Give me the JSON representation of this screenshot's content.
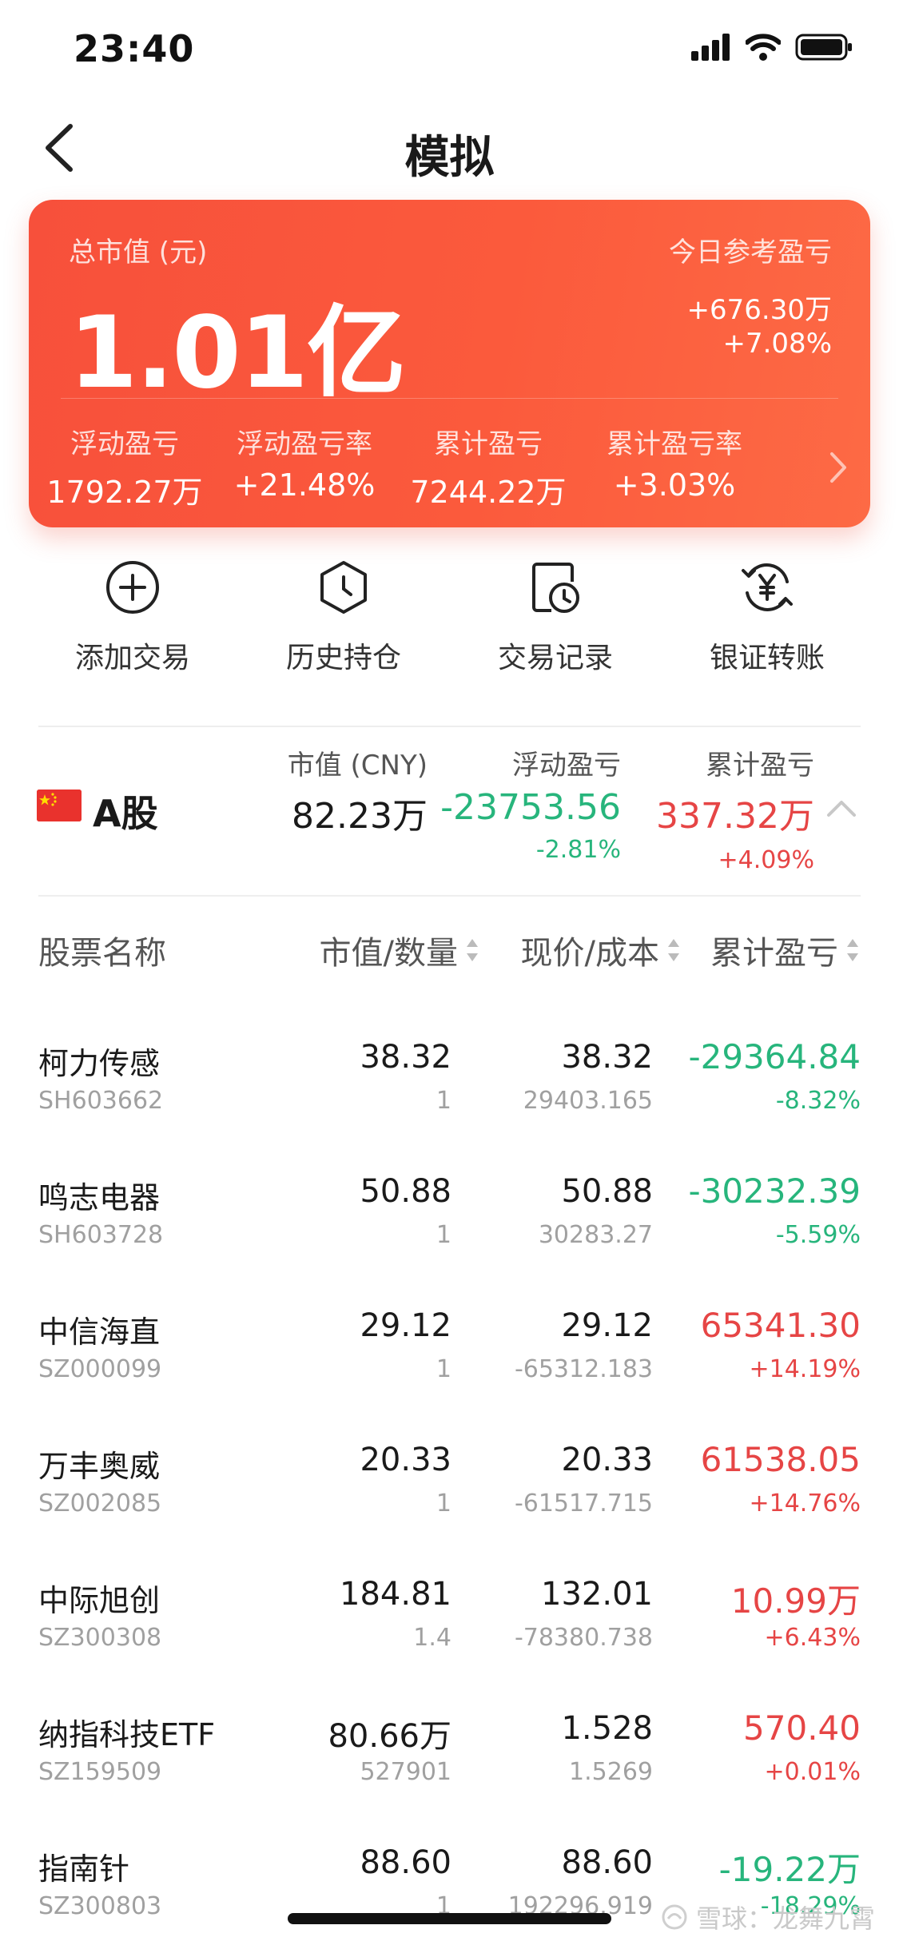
{
  "status_bar": {
    "time": "23:40"
  },
  "nav": {
    "title": "模拟"
  },
  "summary": {
    "total_label": "总市值 (元)",
    "total_value": "1.01亿",
    "today_label": "今日参考盈亏",
    "today_value": "+676.30万",
    "today_pct": "+7.08%",
    "stats": [
      {
        "label": "浮动盈亏",
        "value": "1792.27万"
      },
      {
        "label": "浮动盈亏率",
        "value": "+21.48%"
      },
      {
        "label": "累计盈亏",
        "value": "7244.22万"
      },
      {
        "label": "累计盈亏率",
        "value": "+3.03%"
      }
    ]
  },
  "actions": [
    {
      "label": "添加交易",
      "icon": "plus-circle-icon"
    },
    {
      "label": "历史持仓",
      "icon": "hexagon-clock-icon"
    },
    {
      "label": "交易记录",
      "icon": "record-clock-icon"
    },
    {
      "label": "银证转账",
      "icon": "yuan-transfer-icon"
    }
  ],
  "market": {
    "name": "A股",
    "flag": "china-flag-icon",
    "market_value_label": "市值 (CNY)",
    "market_value": "82.23万",
    "float_label": "浮动盈亏",
    "float_value": "-23753.56",
    "float_pct": "-2.81%",
    "cum_label": "累计盈亏",
    "cum_value": "337.32万",
    "cum_pct": "+4.09%"
  },
  "table": {
    "headers": [
      "股票名称",
      "市值/数量",
      "现价/成本",
      "累计盈亏"
    ],
    "rows": [
      {
        "name": "柯力传感",
        "code": "SH603662",
        "value": "38.32",
        "qty": "1",
        "price": "38.32",
        "cost": "29403.165",
        "pnl": "-29364.84",
        "pct": "-8.32%",
        "dir": "down"
      },
      {
        "name": "鸣志电器",
        "code": "SH603728",
        "value": "50.88",
        "qty": "1",
        "price": "50.88",
        "cost": "30283.27",
        "pnl": "-30232.39",
        "pct": "-5.59%",
        "dir": "down"
      },
      {
        "name": "中信海直",
        "code": "SZ000099",
        "value": "29.12",
        "qty": "1",
        "price": "29.12",
        "cost": "-65312.183",
        "pnl": "65341.30",
        "pct": "+14.19%",
        "dir": "up"
      },
      {
        "name": "万丰奥威",
        "code": "SZ002085",
        "value": "20.33",
        "qty": "1",
        "price": "20.33",
        "cost": "-61517.715",
        "pnl": "61538.05",
        "pct": "+14.76%",
        "dir": "up"
      },
      {
        "name": "中际旭创",
        "code": "SZ300308",
        "value": "184.81",
        "qty": "1.4",
        "price": "132.01",
        "cost": "-78380.738",
        "pnl": "10.99万",
        "pct": "+6.43%",
        "dir": "up"
      },
      {
        "name": "纳指科技ETF",
        "code": "SZ159509",
        "value": "80.66万",
        "qty": "527901",
        "price": "1.528",
        "cost": "1.5269",
        "pnl": "570.40",
        "pct": "+0.01%",
        "dir": "up"
      },
      {
        "name": "指南针",
        "code": "SZ300803",
        "value": "88.60",
        "qty": "1",
        "price": "88.60",
        "cost": "192296.919",
        "pnl": "-19.22万",
        "pct": "-18.29%",
        "dir": "down"
      }
    ]
  },
  "watermark": "雪球：龙舞九霄",
  "colors": {
    "up": "#e64545",
    "down": "#27b57c",
    "card": "#f9553c"
  }
}
